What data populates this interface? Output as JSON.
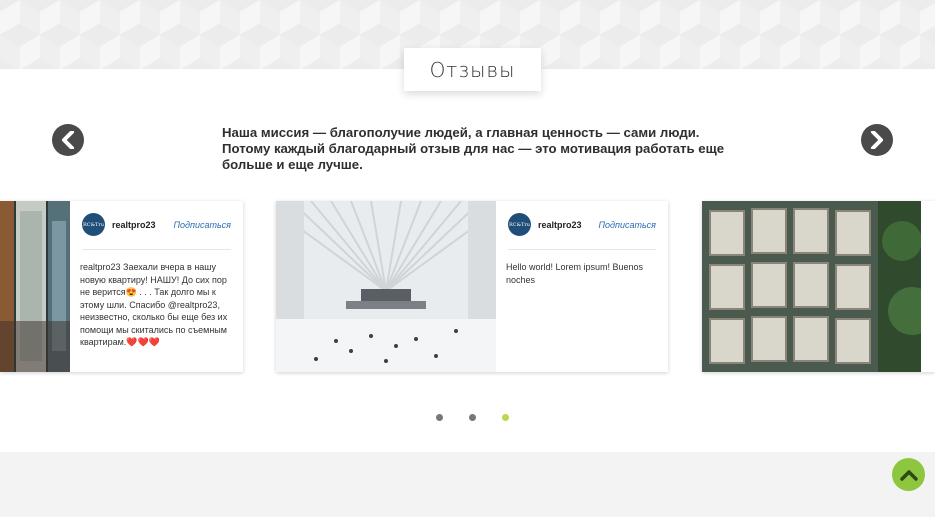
{
  "section": {
    "title": "Отзывы",
    "mission": "Наша миссия — благополучие людей, а главная ценность — сами люди. Потому каждый благодарный отзыв для нас — это мотивация работать еще больше и еще лучше."
  },
  "carousel": {
    "cards": [
      {
        "username": "realtpro23",
        "follow_label": "Подписаться",
        "avatar_text": "RC&Tru",
        "text": "realtpro23 Заехали вчера в нашу новую квартиру! НАШУ! До сих пор не верится😍 . . . Так долго мы к этому шли. Спасибо @realtpro23, неизвестно, сколько бы еще без их помощи мы скитались по съемным квартирам.❤️❤️❤️"
      },
      {
        "username": "realtpro23",
        "follow_label": "Подписаться",
        "avatar_text": "RC&Tru",
        "text": "Hello world! Lorem ipsum! Buenos noches"
      }
    ],
    "pagination": {
      "count": 3,
      "active_index": 2
    }
  },
  "icons": {
    "prev": "chevron-left-icon",
    "next": "chevron-right-icon",
    "scroll_top": "chevron-up-icon"
  },
  "colors": {
    "accent": "#8dc63f",
    "active_dot": "#b9d84a",
    "arrow_bg": "#4a4a4a",
    "link": "#2a6cb0"
  }
}
